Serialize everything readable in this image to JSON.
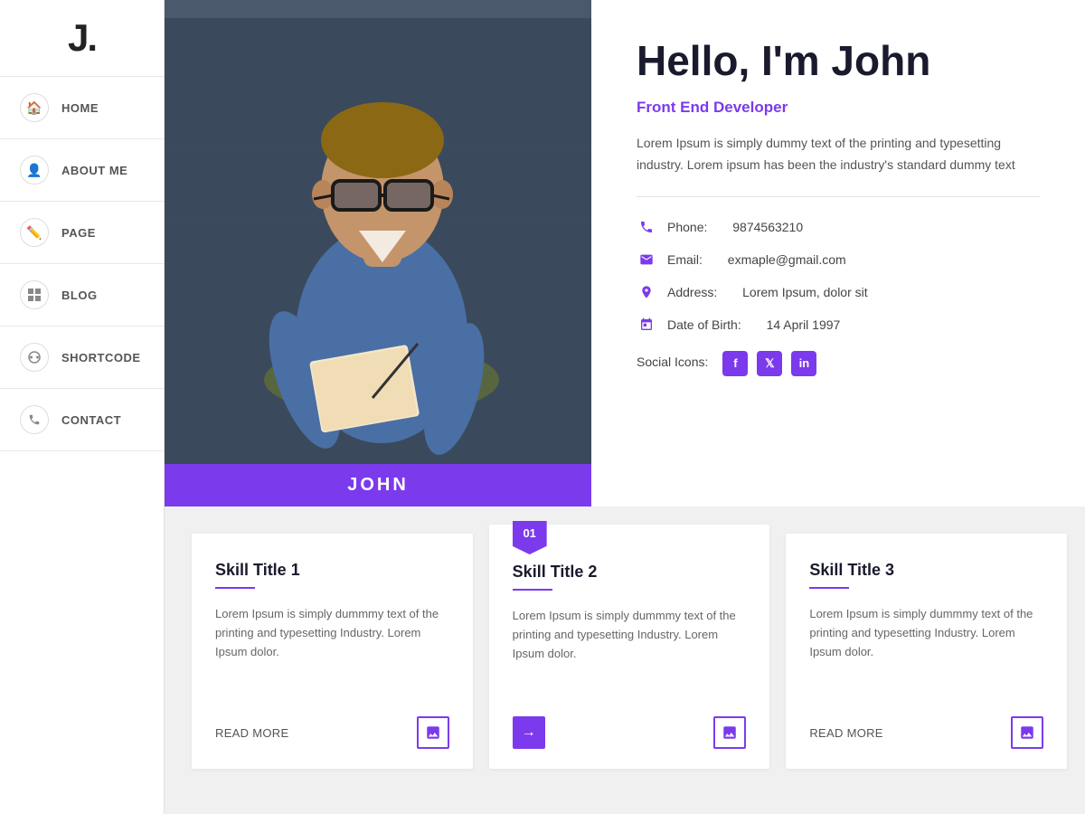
{
  "logo": {
    "text": "J."
  },
  "sidebar": {
    "items": [
      {
        "id": "home",
        "label": "HOME",
        "icon": "🏠"
      },
      {
        "id": "about",
        "label": "ABOUT ME",
        "icon": "👤"
      },
      {
        "id": "page",
        "label": "PAGE",
        "icon": "✏️"
      },
      {
        "id": "blog",
        "label": "BLOG",
        "icon": "⊞"
      },
      {
        "id": "shortcode",
        "label": "SHORTCODE",
        "icon": "⚙️"
      },
      {
        "id": "contact",
        "label": "CONTACT",
        "icon": "📞"
      }
    ]
  },
  "hero": {
    "name_bar": "JOHN",
    "greeting": "Hello, I'm John",
    "role": "Front End Developer",
    "description": "Lorem Ipsum is simply dummy text of the printing and typesetting industry. Lorem ipsum has been the industry's standard dummy text",
    "phone_label": "Phone:",
    "phone_value": "9874563210",
    "email_label": "Email:",
    "email_value": "exmaple@gmail.com",
    "address_label": "Address:",
    "address_value": "Lorem Ipsum, dolor sit",
    "dob_label": "Date of Birth:",
    "dob_value": "14 April 1997",
    "social_label": "Social Icons:"
  },
  "skills": [
    {
      "title": "Skill Title 1",
      "text": "Lorem Ipsum is simply dummmy text of the printing and typesetting Industry. Lorem Ipsum dolor.",
      "read_more": "READ MORE",
      "badge": null
    },
    {
      "title": "Skill Title 2",
      "text": "Lorem Ipsum is simply dummmy text of the printing and typesetting Industry. Lorem Ipsum dolor.",
      "read_more": null,
      "badge": "01",
      "featured": true
    },
    {
      "title": "Skill Title 3",
      "text": "Lorem Ipsum is simply dummmy text of the printing and typesetting Industry. Lorem Ipsum dolor.",
      "read_more": "READ MORE",
      "badge": null
    }
  ]
}
